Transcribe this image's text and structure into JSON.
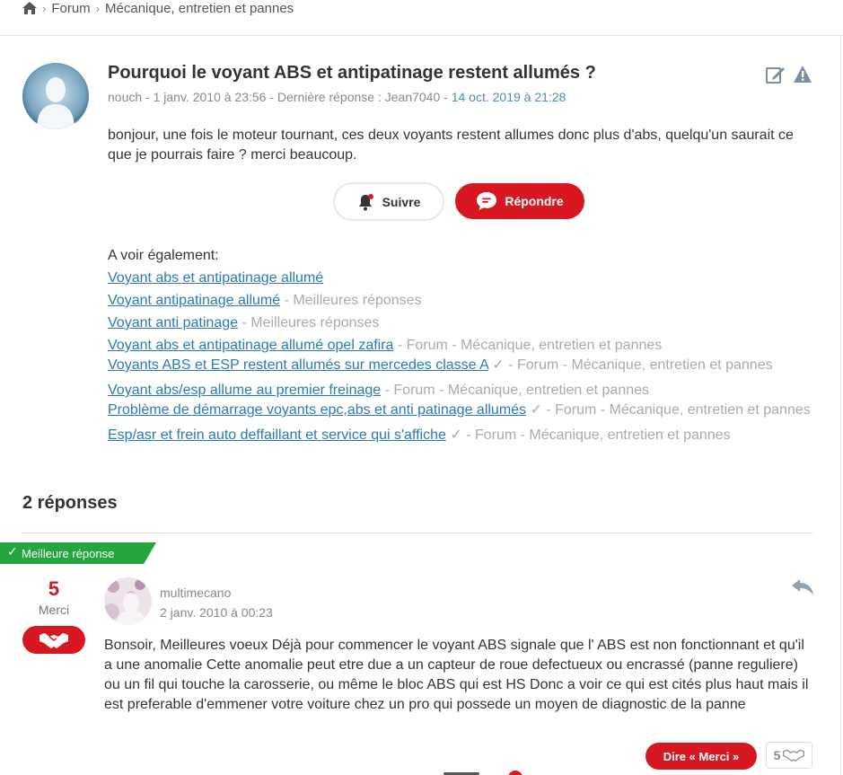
{
  "breadcrumb": {
    "items": [
      "Forum",
      "Mécanique, entretien et pannes"
    ]
  },
  "question": {
    "title": "Pourquoi le voyant ABS et antipatinage restent allumés ?",
    "author": "nouch",
    "date": "1 janv. 2010 à 23:56",
    "last_reply_label": "Dernière réponse :",
    "last_reply_author": "Jean7040",
    "last_reply_date": "14 oct. 2019 à 21:28",
    "body": "bonjour, une fois le moteur tournant, ces deux voyants restent allumes donc plus d'abs, quelqu'un saurait ce que je pourrais faire ? merci beaucoup."
  },
  "actions": {
    "follow_label": "Suivre",
    "reply_label": "Répondre"
  },
  "see_also": {
    "heading": "A voir également:",
    "items": [
      {
        "title": "Voyant abs et antipatinage allumé",
        "suffix": ""
      },
      {
        "title": "Voyant antipatinage allumé",
        "suffix": " - Meilleures réponses"
      },
      {
        "title": "Voyant anti patinage",
        "suffix": " - Meilleures réponses"
      },
      {
        "title": "Voyant abs et antipatinage allumé opel zafira",
        "suffix": " - Forum - Mécanique, entretien et pannes"
      },
      {
        "title": "Voyants ABS et ESP restent allumés sur mercedes classe A",
        "suffix": " ✓ - Forum - Mécanique, entretien et pannes"
      },
      {
        "title": "Voyant abs/esp allume au premier freinage",
        "suffix": " - Forum - Mécanique, entretien et pannes"
      },
      {
        "title": "Problème de démarrage voyants epc,abs et anti patinage allumés",
        "suffix": " ✓ - Forum - Mécanique, entretien et pannes"
      },
      {
        "title": "Esp/asr et frein auto deffaillant et service qui s'affiche",
        "suffix": " ✓ - Forum - Mécanique, entretien et pannes"
      }
    ]
  },
  "answers": {
    "count_label": "2 réponses",
    "best": {
      "badge": "Meilleure réponse",
      "votes": "5",
      "votes_label": "Merci",
      "author": "multimecano",
      "date": "2 janv. 2010 à 00:23",
      "body": "Bonsoir, Meilleures voeux Déjà pour commencer le voyant ABS signale que l' ABS est non fonctionnant et qu'il a une anomalie Cette anomalie peut etre due a un capteur de roue defectueux ou encrassé (panne reguliere) ou un fil qui touche la carosserie, ou même le bloc ABS qui est HS Donc a voir ce qui est cités plus haut mais il est preferable d'emmener votre voiture chez un pro qui possede un moyen de diagnostic de la panne",
      "merci_button": "Dire « Merci »",
      "merci_count": "5"
    }
  },
  "colors": {
    "accent_red": "#d71820",
    "link_blue": "#2a7ab8",
    "best_green": "#24a540"
  },
  "icons": [
    "home-icon",
    "chevron-right-icon",
    "edit-icon",
    "warning-icon",
    "bell-icon",
    "chat-bubble-icon",
    "check-icon",
    "handshake-icon",
    "reply-icon"
  ]
}
